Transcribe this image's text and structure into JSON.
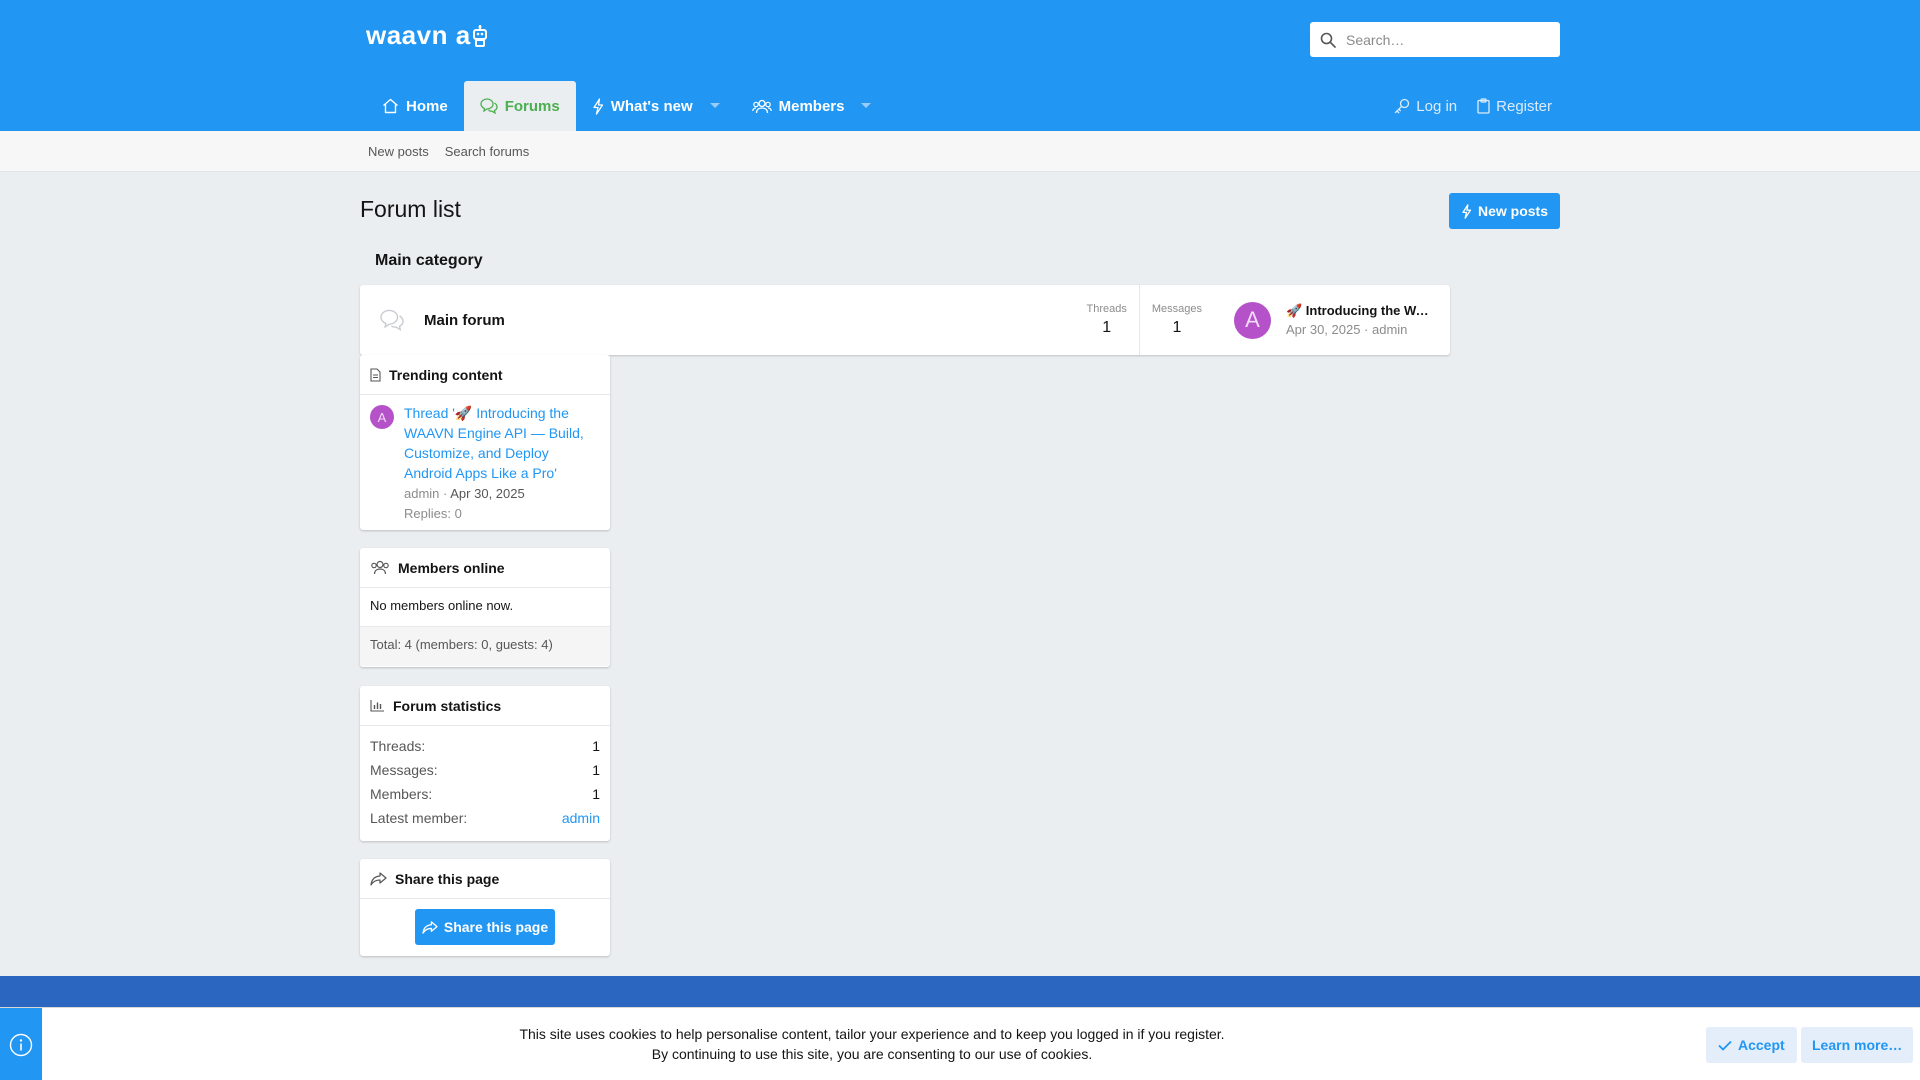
{
  "header": {
    "logo_text": "waavn a",
    "search_placeholder": "Search…"
  },
  "nav": {
    "tabs": [
      {
        "label": "Home"
      },
      {
        "label": "Forums"
      },
      {
        "label": "What's new"
      },
      {
        "label": "Members"
      }
    ],
    "login_label": "Log in",
    "register_label": "Register"
  },
  "subnav": {
    "items": [
      {
        "label": "New posts"
      },
      {
        "label": "Search forums"
      }
    ]
  },
  "page": {
    "title": "Forum list",
    "new_posts_button": "New posts"
  },
  "category": {
    "title": "Main category",
    "forums": [
      {
        "name": "Main forum",
        "threads_label": "Threads",
        "threads": "1",
        "messages_label": "Messages",
        "messages": "1",
        "latest_avatar": "A",
        "latest_title": "🚀 Introducing the WAAVN Engine API — Build, Customize, and Deploy Android Apps Like a Pro",
        "latest_meta": "Apr 30, 2025 · admin"
      }
    ]
  },
  "trending": {
    "title": "Trending content",
    "items": [
      {
        "avatar": "A",
        "link": "Thread '🚀 Introducing the WAAVN Engine API — Build, Customize, and Deploy Android Apps Like a Pro'",
        "author": "admin",
        "separator": " · ",
        "date": "Apr 30, 2025",
        "replies": "Replies: 0"
      }
    ]
  },
  "members_online": {
    "title": "Members online",
    "status": "No members online now.",
    "total": "Total: 4 (members: 0, guests: 4)"
  },
  "forum_statistics": {
    "title": "Forum statistics",
    "rows": [
      {
        "key": "Threads:",
        "value": "1"
      },
      {
        "key": "Messages:",
        "value": "1"
      },
      {
        "key": "Members:",
        "value": "1"
      },
      {
        "key": "Latest member:",
        "value": "admin"
      }
    ]
  },
  "share": {
    "title": "Share this page",
    "button": "Share this page"
  },
  "cookie": {
    "line1": "This site uses cookies to help personalise content, tailor your experience and to keep you logged in if you register.",
    "line2": "By continuing to use this site, you are consenting to our use of cookies.",
    "accept": "Accept",
    "learn_more": "Learn more…"
  },
  "colors": {
    "brand": "#2196f3",
    "active_tab_text": "#4caf50",
    "footer": "#2b66c0",
    "avatar": "#b552c9"
  }
}
